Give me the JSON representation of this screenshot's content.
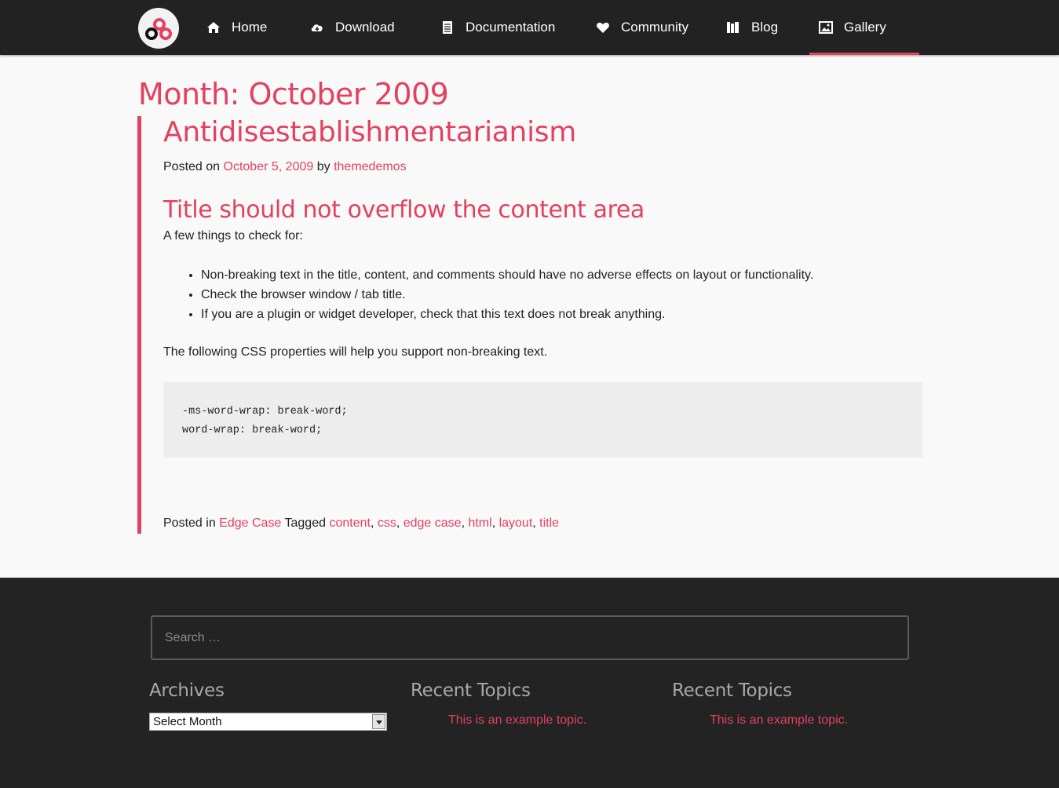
{
  "nav": {
    "logo_icon": "rings-logo-icon",
    "items": [
      {
        "label": "Home",
        "icon": "home-icon"
      },
      {
        "label": "Download",
        "icon": "cloud-download-icon"
      },
      {
        "label": "Documentation",
        "icon": "document-icon"
      },
      {
        "label": "Community",
        "icon": "heart-icon"
      },
      {
        "label": "Blog",
        "icon": "blog-icon"
      },
      {
        "label": "Gallery",
        "icon": "image-icon"
      }
    ],
    "active": "Gallery"
  },
  "page_title": "Month: October 2009",
  "post": {
    "title": "Antidisestablishmentarianism",
    "posted_on_prefix": "Posted on",
    "date": "October 5, 2009",
    "by": "by",
    "author": "themedemos",
    "subtitle": "Title should not overflow the content area",
    "intro": "A few things to check for:",
    "list": [
      "Non-breaking text in the title, content, and comments should have no adverse effects on layout or functionality.",
      "Check the browser window / tab title.",
      "If you are a plugin or widget developer, check that this text does not break anything."
    ],
    "paragraph": "The following CSS properties will help you support non-breaking text.",
    "code_lines": [
      "-ms-word-wrap: break-word;",
      "word-wrap: break-word;"
    ],
    "posted_in_prefix": "Posted in",
    "category": "Edge Case",
    "tagged": "Tagged",
    "tags": [
      "content",
      "css",
      "edge case",
      "html",
      "layout",
      "title"
    ]
  },
  "footer": {
    "search_placeholder": "Search …",
    "archives_title": "Archives",
    "archives_select": "Select Month",
    "recent_title_1": "Recent Topics",
    "recent_link_1": "This is an example topic.",
    "recent_title_2": "Recent Topics",
    "recent_link_2": "This is an example topic."
  },
  "colors": {
    "accent": "#e2415f",
    "nav_bg": "#222222",
    "footer_bg": "#232323",
    "page_bg": "#f9f9f9"
  }
}
